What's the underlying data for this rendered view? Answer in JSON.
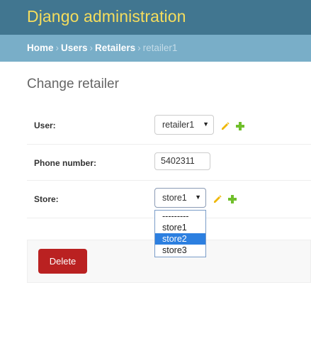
{
  "header": {
    "branding": "Django administration"
  },
  "breadcrumbs": {
    "items": [
      "Home",
      "Users",
      "Retailers"
    ],
    "current": "retailer1",
    "separator": "›"
  },
  "page": {
    "title": "Change retailer"
  },
  "form": {
    "user": {
      "label": "User:",
      "selected": "retailer1",
      "edit_icon": "pencil-icon",
      "add_icon": "plus-icon"
    },
    "phone": {
      "label": "Phone number:",
      "value": "5402311"
    },
    "store": {
      "label": "Store:",
      "selected": "store1",
      "options": [
        "---------",
        "store1",
        "store2",
        "store3"
      ],
      "highlighted_option": "store2",
      "edit_icon": "pencil-icon",
      "add_icon": "plus-icon"
    }
  },
  "actions": {
    "delete_label": "Delete"
  },
  "colors": {
    "header_bg": "#417690",
    "branding": "#f5dd5d",
    "breadcrumbs_bg": "#79aec8",
    "delete_bg": "#ba2121",
    "option_highlight": "#2c7fe0",
    "edit_icon": "#efb80b",
    "add_icon": "#70bf2b"
  }
}
